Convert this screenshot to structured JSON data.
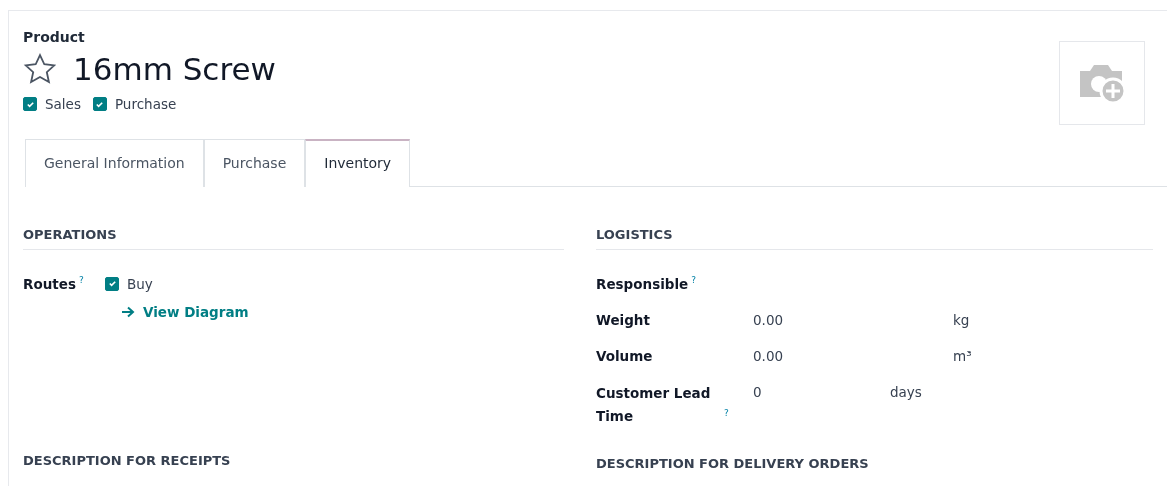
{
  "header": {
    "caption": "Product",
    "title": "16mm Screw",
    "favorite": false,
    "flags": [
      {
        "label": "Sales",
        "checked": true
      },
      {
        "label": "Purchase",
        "checked": true
      }
    ]
  },
  "tabs": [
    {
      "label": "General Information",
      "selected": false
    },
    {
      "label": "Purchase",
      "selected": false
    },
    {
      "label": "Inventory",
      "selected": true
    }
  ],
  "operations": {
    "heading": "OPERATIONS",
    "routes": {
      "label": "Routes",
      "help": "?",
      "options": [
        {
          "label": "Buy",
          "checked": true
        }
      ],
      "link": "View Diagram"
    }
  },
  "logistics": {
    "heading": "LOGISTICS",
    "fields": [
      {
        "label": "Responsible",
        "help": "?"
      },
      {
        "label": "Weight",
        "value": "0.00",
        "unit": "kg",
        "kind": "wide"
      },
      {
        "label": "Volume",
        "value": "0.00",
        "unit": "m³",
        "kind": "wide"
      },
      {
        "label": "Customer Lead Time",
        "help": "?",
        "value": "0",
        "unit": "days",
        "kind": "narrow"
      }
    ]
  },
  "bottom_headings": [
    "DESCRIPTION FOR RECEIPTS",
    "DESCRIPTION FOR DELIVERY ORDERS"
  ]
}
